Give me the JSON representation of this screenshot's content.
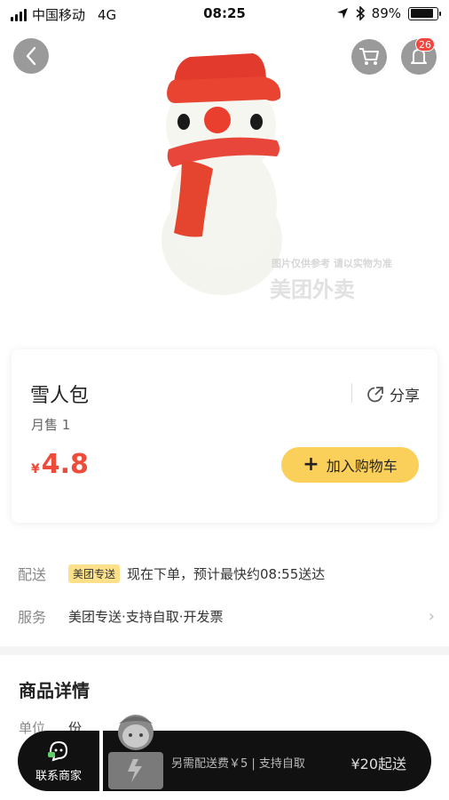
{
  "status_bar": {
    "carrier": "中国移动",
    "network": "4G",
    "time": "08:25",
    "battery_percent": "89%",
    "battery_level": 0.89
  },
  "hero": {
    "image_subject": "雪人包",
    "watermark_note": "图片仅供参考 请以实物为准",
    "watermark_logo": "美团外卖",
    "notification_count": "26",
    "icons": [
      "back-icon",
      "cart-icon",
      "bell-icon"
    ]
  },
  "product": {
    "name": "雪人包",
    "share_label": "分享",
    "monthly_sales": "月售 1",
    "price_symbol": "¥",
    "price": "4.8",
    "add_to_cart_label": "加入购物车"
  },
  "delivery": {
    "label": "配送",
    "tag": "美团专送",
    "text": "现在下单，预计最快约08:55送达"
  },
  "service": {
    "label": "服务",
    "text": "美团专送·支持自取·开发票"
  },
  "details": {
    "title": "商品详情",
    "unit_label": "单位",
    "unit_value": "份"
  },
  "bottom_bar": {
    "contact_label": "联系商家",
    "delivery_note": "另需配送费￥5 | 支持自取",
    "min_order": "¥20起送"
  },
  "colors": {
    "accent_yellow": "#fbd05a",
    "price_red": "#ee4b3a",
    "badge_red": "#f5453c",
    "bar_black": "#111111"
  }
}
